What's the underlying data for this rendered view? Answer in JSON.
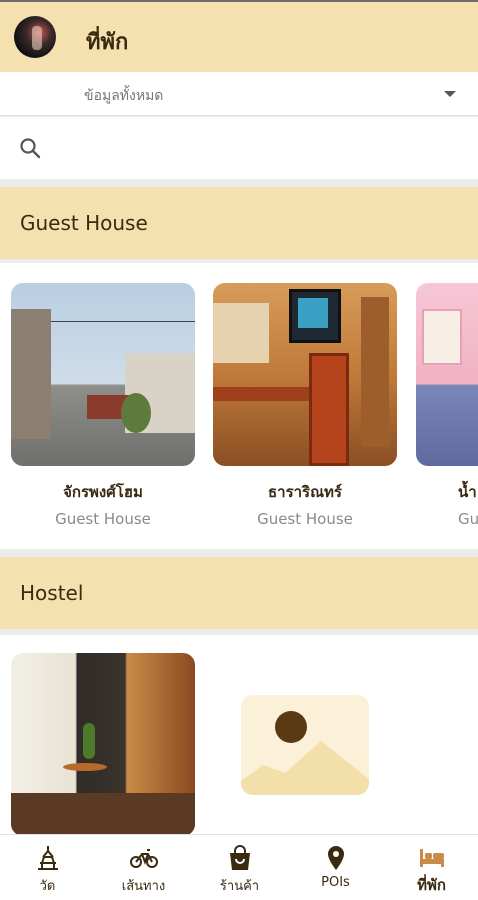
{
  "header": {
    "title": "ที่พัก"
  },
  "filter": {
    "selected": "ข้อมูลทั้งหมด"
  },
  "search": {
    "placeholder": ""
  },
  "sections": [
    {
      "title": "Guest House",
      "cards": [
        {
          "name": "จักรพงศ์โฮม",
          "type": "Guest House"
        },
        {
          "name": "ธาราริณทร์",
          "type": "Guest House"
        },
        {
          "name": "น้ำ",
          "type": "Gu"
        }
      ]
    },
    {
      "title": "Hostel",
      "cards": [
        {
          "name": "",
          "type": ""
        }
      ]
    }
  ],
  "bottom_nav": [
    {
      "label": "วัด",
      "icon": "temple-icon"
    },
    {
      "label": "เส้นทาง",
      "icon": "bicycle-icon"
    },
    {
      "label": "ร้านค้า",
      "icon": "shopping-bag-icon"
    },
    {
      "label": "POIs",
      "icon": "location-pin-icon"
    },
    {
      "label": "ที่พัก",
      "icon": "bed-icon",
      "active": true
    }
  ],
  "colors": {
    "header_bg": "#f5e1b0",
    "text_dark": "#3a2a12",
    "muted": "#8a8a8a"
  }
}
